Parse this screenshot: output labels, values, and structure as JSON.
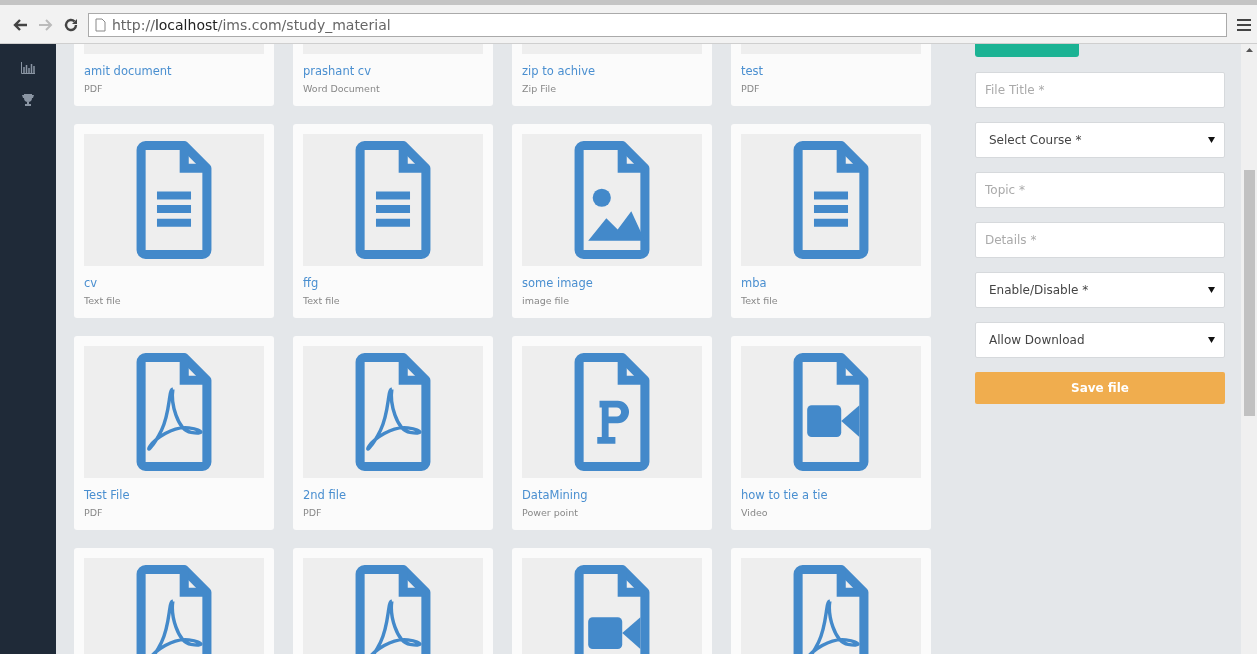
{
  "browser": {
    "address": "http://**localhost**/ims.com/study_material"
  },
  "sidebar": {
    "items": [
      {
        "kind": "chart"
      },
      {
        "kind": "trophy"
      }
    ]
  },
  "files": [
    {
      "name": "amit document",
      "type": "PDF"
    },
    {
      "name": "prashant cv",
      "type": "Word Document"
    },
    {
      "name": "zip to achive",
      "type": "Zip File"
    },
    {
      "name": "test",
      "type": "PDF"
    },
    {
      "name": "cv",
      "type": "Text file",
      "kind": "document"
    },
    {
      "name": "ffg",
      "type": "Text file",
      "kind": "document"
    },
    {
      "name": "some image",
      "type": "image file",
      "kind": "image"
    },
    {
      "name": "mba",
      "type": "Text file",
      "kind": "document"
    },
    {
      "name": "Test File",
      "type": "PDF",
      "kind": "pdf"
    },
    {
      "name": "2nd file",
      "type": "PDF",
      "kind": "pdf"
    },
    {
      "name": "DataMining",
      "type": "Power point",
      "kind": "presentation"
    },
    {
      "name": "how to tie a tie",
      "type": "Video",
      "kind": "video"
    },
    {
      "kind": "pdf"
    },
    {
      "kind": "pdf"
    },
    {
      "kind": "video"
    },
    {
      "kind": "pdf"
    }
  ],
  "form": {
    "fields": [
      {
        "kind": "input",
        "placeholder": "File Title *"
      },
      {
        "kind": "select",
        "value": "Select Course *"
      },
      {
        "kind": "input",
        "placeholder": "Topic *"
      },
      {
        "kind": "input",
        "placeholder": "Details *"
      },
      {
        "kind": "select",
        "value": "Enable/Disable *"
      },
      {
        "kind": "select",
        "value": "Allow Download"
      }
    ],
    "submit": "Save file"
  }
}
